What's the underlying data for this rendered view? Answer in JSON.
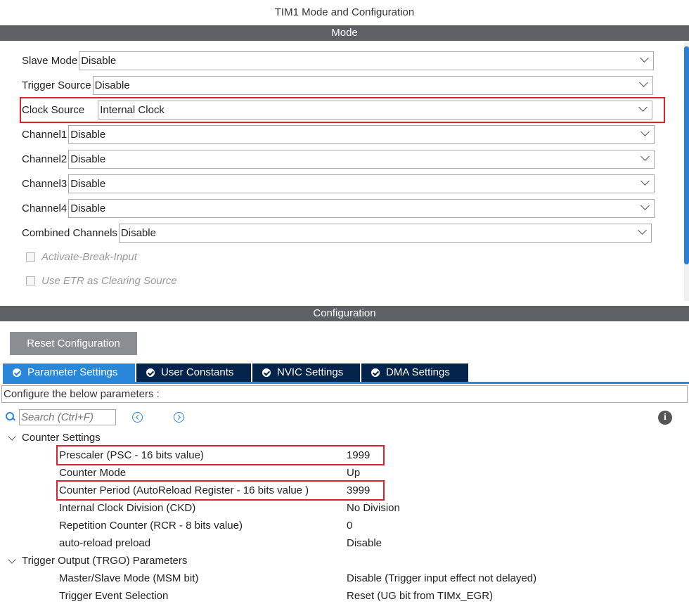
{
  "window": {
    "title": "TIM1 Mode and Configuration"
  },
  "mode": {
    "section_label": "Mode",
    "slave_mode": {
      "label": "Slave Mode",
      "value": "Disable"
    },
    "trigger_source": {
      "label": "Trigger Source",
      "value": "Disable"
    },
    "clock_source": {
      "label": "Clock Source",
      "value": "Internal Clock"
    },
    "channel1": {
      "label": "Channel1",
      "value": "Disable"
    },
    "channel2": {
      "label": "Channel2",
      "value": "Disable"
    },
    "channel3": {
      "label": "Channel3",
      "value": "Disable"
    },
    "channel4": {
      "label": "Channel4",
      "value": "Disable"
    },
    "combined_channels": {
      "label": "Combined Channels",
      "value": "Disable"
    },
    "activate_break_input": {
      "label": "Activate-Break-Input",
      "checked": false
    },
    "use_etr": {
      "label": "Use ETR as Clearing Source",
      "checked": false
    }
  },
  "configuration": {
    "section_label": "Configuration",
    "reset_button": "Reset Configuration",
    "tabs": [
      {
        "label": "Parameter Settings",
        "active": true
      },
      {
        "label": "User Constants",
        "active": false
      },
      {
        "label": "NVIC Settings",
        "active": false
      },
      {
        "label": "DMA Settings",
        "active": false
      }
    ],
    "instructions": "Configure the below parameters :",
    "search_placeholder": "Search (Ctrl+F)",
    "info_icon_glyph": "i",
    "counter_settings": {
      "label": "Counter Settings",
      "params": [
        {
          "name": "Prescaler (PSC - 16 bits value)",
          "value": "1999"
        },
        {
          "name": "Counter Mode",
          "value": "Up"
        },
        {
          "name": "Counter Period (AutoReload Register - 16 bits value )",
          "value": "3999"
        },
        {
          "name": "Internal Clock Division (CKD)",
          "value": "No Division"
        },
        {
          "name": "Repetition Counter (RCR - 8 bits value)",
          "value": "0"
        },
        {
          "name": "auto-reload preload",
          "value": "Disable"
        }
      ]
    },
    "trigger_output": {
      "label": "Trigger Output (TRGO) Parameters",
      "params": [
        {
          "name": "Master/Slave Mode (MSM bit)",
          "value": "Disable (Trigger input effect not delayed)"
        },
        {
          "name": "Trigger Event Selection",
          "value": "Reset (UG bit from TIMx_EGR)"
        }
      ]
    }
  },
  "colors": {
    "section_bar": "#5d6166",
    "active_tab": "#2a86d8",
    "inactive_tab": "#03234b",
    "highlight": "#d9232e"
  }
}
